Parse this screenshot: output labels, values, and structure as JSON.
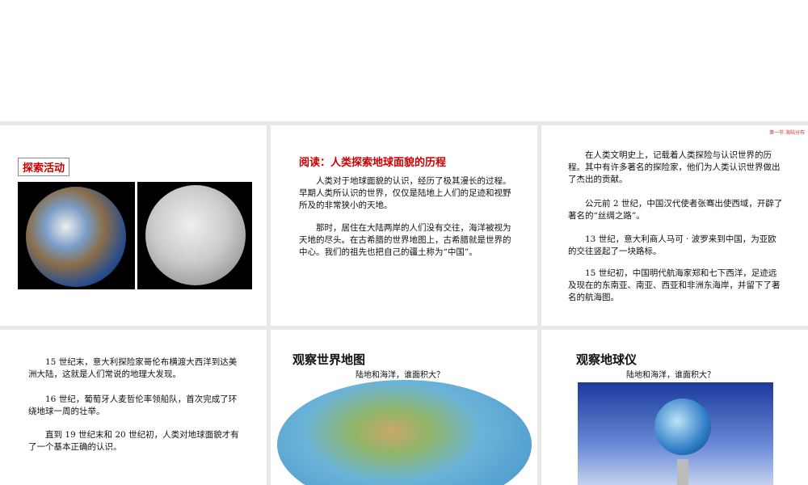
{
  "slides": [
    {
      "label": "探索活动"
    },
    {
      "title": "阅读：人类探索地球面貌的历程",
      "paragraphs": [
        "人类对于地球面貌的认识，经历了极其漫长的过程。早期人类所认识的世界，仅仅是陆地上人们的足迹和视野所及的非常狭小的天地。",
        "那时，居住在大陆两岸的人们没有交往，海洋被视为天地的尽头。在古希腊的世界地图上，古希腊就是世界的中心。我们的祖先也把自己的疆土称为“中国”。"
      ]
    },
    {
      "header": "第一节 海陆分布",
      "paragraphs": [
        "在人类文明史上，记载着人类探险与认识世界的历程。其中有许多著名的探险家，他们为人类认识世界做出了杰出的贡献。",
        "公元前 2 世纪，中国汉代使者张骞出使西域，开辟了著名的“丝绸之路”。",
        "13 世纪，意大利商人马可 · 波罗来到中国，为亚欧的交往竖起了一块路标。",
        "15 世纪初，中国明代航海家郑和七下西洋，足迹远及现在的东南亚、南亚、西亚和非洲东海岸，并留下了著名的航海图。"
      ]
    },
    {
      "paragraphs": [
        "15 世纪末，意大利探险家哥伦布横渡大西洋到达美洲大陆，这就是人们常说的地理大发现。",
        "16 世纪，葡萄牙人麦哲伦率领船队，首次完成了环绕地球一周的壮举。",
        "直到 19 世纪末和 20 世纪初，人类对地球面貌才有了一个基本正确的认识。"
      ]
    },
    {
      "title": "观察世界地图",
      "subtitle": "陆地和海洋，谁面积大？"
    },
    {
      "title": "观察地球仪",
      "subtitle": "陆地和海洋，谁面积大？"
    }
  ]
}
